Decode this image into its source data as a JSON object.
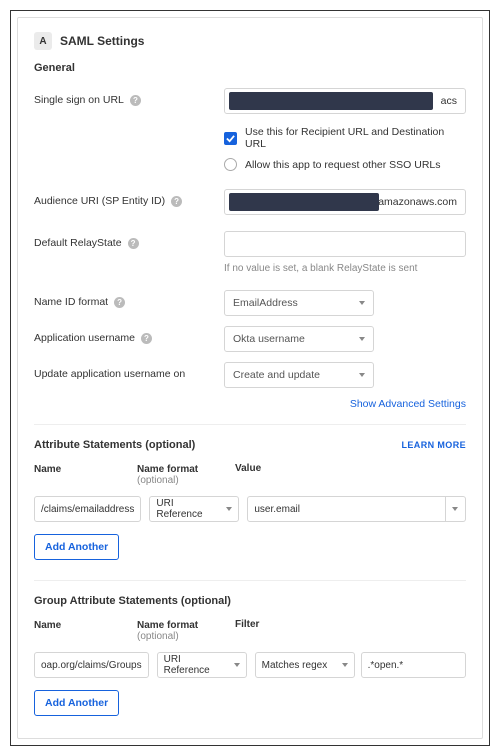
{
  "header": {
    "badge": "A",
    "title": "SAML Settings"
  },
  "general": {
    "heading": "General",
    "sso_url_label": "Single sign on URL",
    "sso_url_tail": "acs",
    "use_recipient_label": "Use this for Recipient URL and Destination URL",
    "allow_other_label": "Allow this app to request other SSO URLs",
    "audience_label": "Audience URI (SP Entity ID)",
    "audience_tail": "amazonaws.com",
    "relaystate_label": "Default RelayState",
    "relaystate_help": "If no value is set, a blank RelayState is sent",
    "nameid_label": "Name ID format",
    "nameid_value": "EmailAddress",
    "app_username_label": "Application username",
    "app_username_value": "Okta username",
    "update_on_label": "Update application username on",
    "update_on_value": "Create and update",
    "show_advanced": "Show Advanced Settings"
  },
  "attr": {
    "heading": "Attribute Statements (optional)",
    "learn_more": "LEARN MORE",
    "col_name": "Name",
    "col_format": "Name format",
    "col_format_sub": "(optional)",
    "col_value": "Value",
    "row": {
      "name": "/claims/emailaddress",
      "format": "URI Reference",
      "value": "user.email"
    },
    "add_another": "Add Another"
  },
  "group": {
    "heading": "Group Attribute Statements (optional)",
    "col_name": "Name",
    "col_format": "Name format",
    "col_format_sub": "(optional)",
    "col_filter": "Filter",
    "row": {
      "name": "oap.org/claims/Groups",
      "format": "URI Reference",
      "filter_type": "Matches regex",
      "filter_value": ".*open.*"
    },
    "add_another": "Add Another"
  }
}
